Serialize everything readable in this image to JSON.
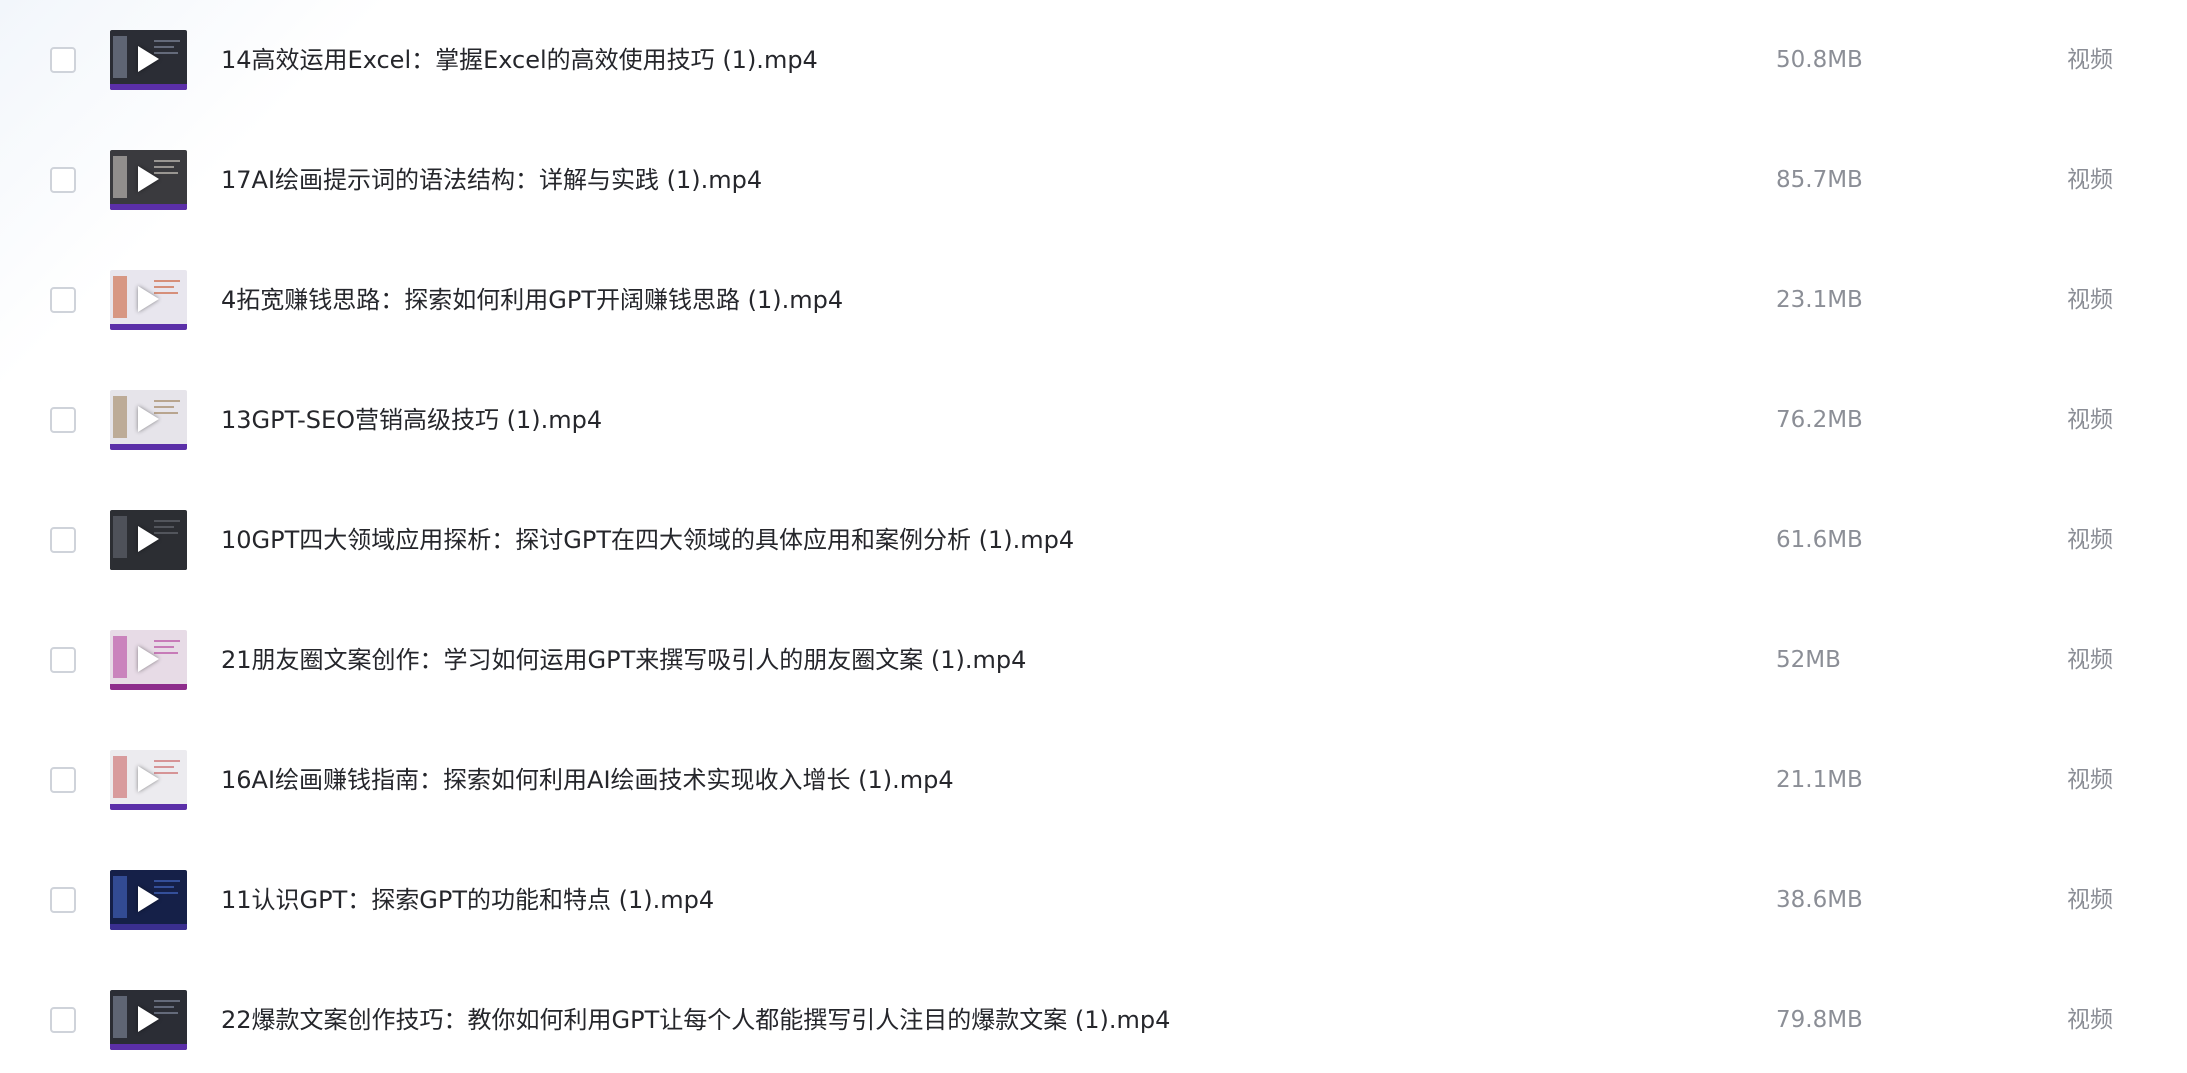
{
  "files": [
    {
      "name": "14高效运用Excel：掌握Excel的高效使用技巧 (1).mp4",
      "size": "50.8MB",
      "type": "视频",
      "thumb_bg": "#2b2d35",
      "thumb_accent": "#8a93a8",
      "thumb_bar": "#5b2fa8"
    },
    {
      "name": "17AI绘画提示词的语法结构：详解与实践 (1).mp4",
      "size": "85.7MB",
      "type": "视频",
      "thumb_bg": "#3a3a3e",
      "thumb_accent": "#d8d4cc",
      "thumb_bar": "#5b2fa8"
    },
    {
      "name": "4拓宽赚钱思路：探索如何利用GPT开阔赚钱思路 (1).mp4",
      "size": "23.1MB",
      "type": "视频",
      "thumb_bg": "#e8e6ee",
      "thumb_accent": "#c9552d",
      "thumb_bar": "#5b2fa8"
    },
    {
      "name": "13GPT-SEO营销高级技巧 (1).mp4",
      "size": "76.2MB",
      "type": "视频",
      "thumb_bg": "#e6e4ea",
      "thumb_accent": "#9a7b52",
      "thumb_bar": "#5b2fa8"
    },
    {
      "name": "10GPT四大领域应用探析：探讨GPT在四大领域的具体应用和案例分析 (1).mp4",
      "size": "61.6MB",
      "type": "视频",
      "thumb_bg": "#2c2e33",
      "thumb_accent": "#6c7078",
      "thumb_bar": "#2c2e33"
    },
    {
      "name": "21朋友圈文案创作：学习如何运用GPT来撰写吸引人的朋友圈文案 (1).mp4",
      "size": "52MB",
      "type": "视频",
      "thumb_bg": "#e7dbe6",
      "thumb_accent": "#b23a9a",
      "thumb_bar": "#8e2c8c"
    },
    {
      "name": "16AI绘画赚钱指南：探索如何利用AI绘画技术实现收入增长 (1).mp4",
      "size": "21.1MB",
      "type": "视频",
      "thumb_bg": "#ecebef",
      "thumb_accent": "#c85a5a",
      "thumb_bar": "#5b2fa8"
    },
    {
      "name": "11认识GPT：探索GPT的功能和特点 (1).mp4",
      "size": "38.6MB",
      "type": "视频",
      "thumb_bg": "#152048",
      "thumb_accent": "#4a6fd1",
      "thumb_bar": "#3a2f8f"
    },
    {
      "name": "22爆款文案创作技巧：教你如何利用GPT让每个人都能撰写引人注目的爆款文案 (1).mp4",
      "size": "79.8MB",
      "type": "视频",
      "thumb_bg": "#2b2d35",
      "thumb_accent": "#8a93a8",
      "thumb_bar": "#5b2fa8"
    }
  ]
}
